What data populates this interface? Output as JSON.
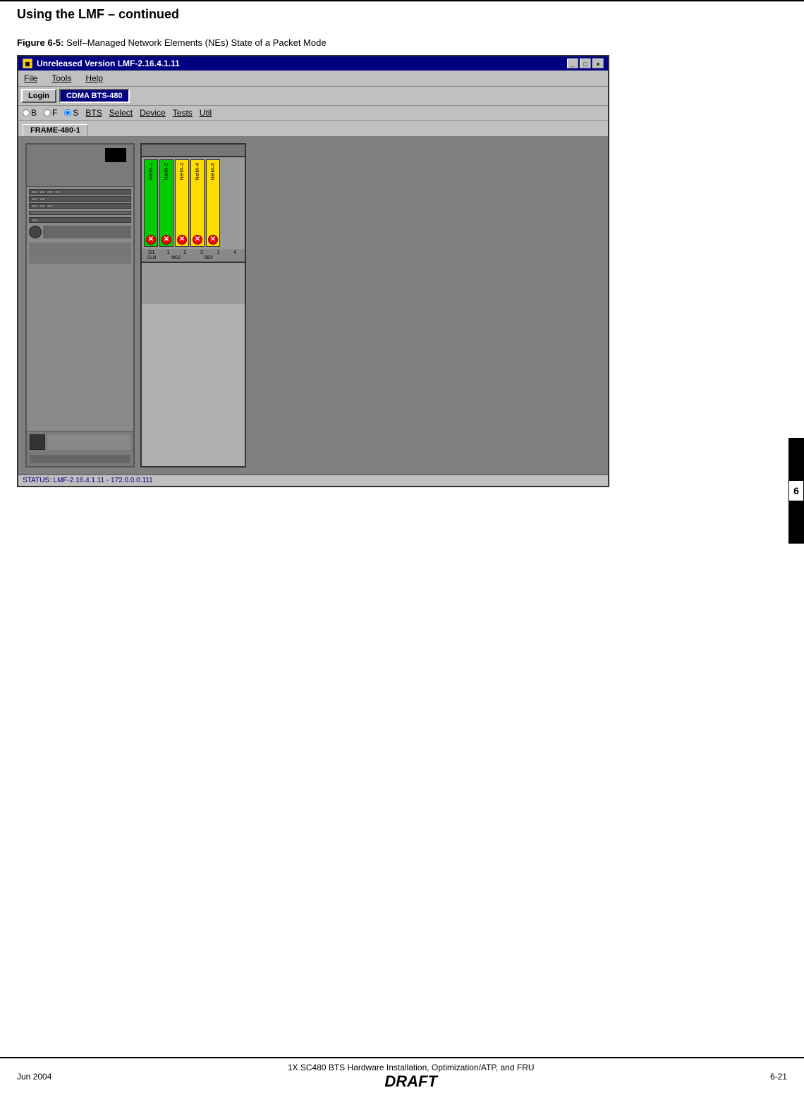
{
  "page": {
    "title": "Using the LMF",
    "title_continued": " – continued",
    "figure_label": "Figure 6-5:",
    "figure_caption": "Self–Managed Network Elements (NEs) State of a Packet Mode"
  },
  "window": {
    "title": "Unreleased Version LMF-2.16.4.1.11",
    "icon_label": "LMF",
    "minimize": "_",
    "maximize": "□",
    "close": "×"
  },
  "menu": {
    "file": "File",
    "tools": "Tools",
    "help": "Help"
  },
  "toolbar": {
    "login": "Login",
    "cdma_bts": "CDMA BTS-480"
  },
  "navbar": {
    "b_label": "B",
    "f_label": "F",
    "s_label": "S",
    "bts_label": "BTS",
    "select_label": "Select",
    "device_label": "Device",
    "tests_label": "Tests",
    "util_label": "Util"
  },
  "frame_tab": {
    "label": "FRAME-480-1"
  },
  "cards": [
    {
      "id": "c1",
      "color": "green",
      "label": "NetM...1",
      "fault": true
    },
    {
      "id": "c2",
      "color": "green",
      "label": "NetM...2",
      "fault": true
    },
    {
      "id": "c3",
      "color": "yellow",
      "label": "NetM...3",
      "fault": true
    },
    {
      "id": "c4",
      "color": "yellow",
      "label": "NetM...4",
      "fault": true
    },
    {
      "id": "c5",
      "color": "yellow",
      "label": "NetM...5",
      "fault": true
    }
  ],
  "slot_numbers": [
    "G1",
    "1",
    "2",
    "3",
    "1",
    "4"
  ],
  "slot_labels": [
    "GLI3",
    "",
    "MCC",
    "",
    "BBX",
    ""
  ],
  "status_bar": {
    "text": "STATUS: LMF-2.16.4.1.11 - 172.0.0.0.111"
  },
  "chapter_marker": {
    "number": "6"
  },
  "footer": {
    "left": "Jun 2004",
    "center": "1X SC480 BTS Hardware Installation, Optimization/ATP, and FRU",
    "draft": "DRAFT",
    "right": "6-21"
  }
}
